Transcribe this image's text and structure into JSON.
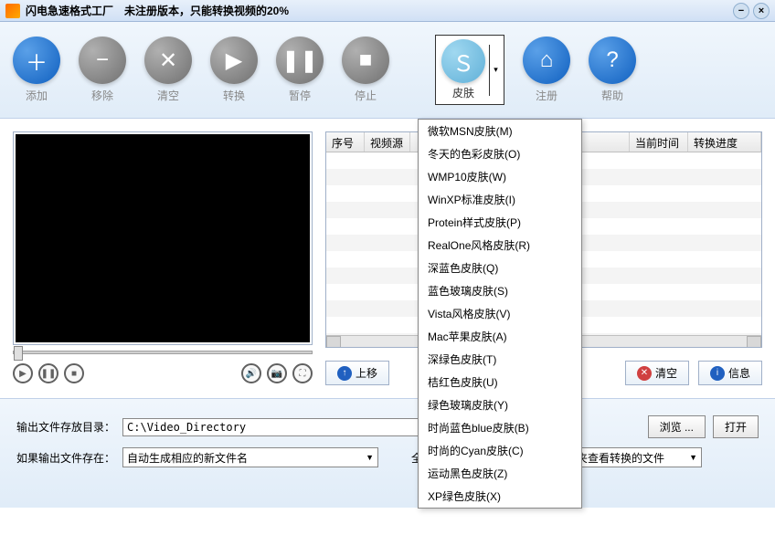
{
  "titlebar": {
    "title": "闪电急速格式工厂　未注册版本，只能转换视频的20%"
  },
  "toolbar": {
    "add": "添加",
    "remove": "移除",
    "clear": "清空",
    "convert": "转换",
    "pause": "暂停",
    "stop": "停止",
    "skin": "皮肤",
    "register": "注册",
    "help": "帮助"
  },
  "table": {
    "headers": {
      "seq": "序号",
      "source": "视频源",
      "current": "当前时间",
      "progress": "转换进度"
    }
  },
  "actions": {
    "move_up": "上移",
    "clear": "清空",
    "info": "信息"
  },
  "bottom": {
    "output_dir_label": "输出文件存放目录：",
    "output_dir_value": "C:\\Video_Directory",
    "browse": "浏览 ...",
    "open": "打开",
    "if_exists_label": "如果输出文件存在：",
    "if_exists_value": "自动生成相应的新文件名",
    "after_all_label": "全部文件转换完毕后：",
    "after_all_value": "打开文件夹查看转换的文件"
  },
  "skin_menu": [
    "微软MSN皮肤(M)",
    "冬天的色彩皮肤(O)",
    "WMP10皮肤(W)",
    "WinXP标准皮肤(I)",
    "Protein样式皮肤(P)",
    "RealOne风格皮肤(R)",
    "深蓝色皮肤(Q)",
    "蓝色玻璃皮肤(S)",
    "Vista风格皮肤(V)",
    "Mac苹果皮肤(A)",
    "深绿色皮肤(T)",
    "桔红色皮肤(U)",
    "绿色玻璃皮肤(Y)",
    "时尚蓝色blue皮肤(B)",
    "时尚的Cyan皮肤(C)",
    "运动黑色皮肤(Z)",
    "XP绿色皮肤(X)"
  ]
}
